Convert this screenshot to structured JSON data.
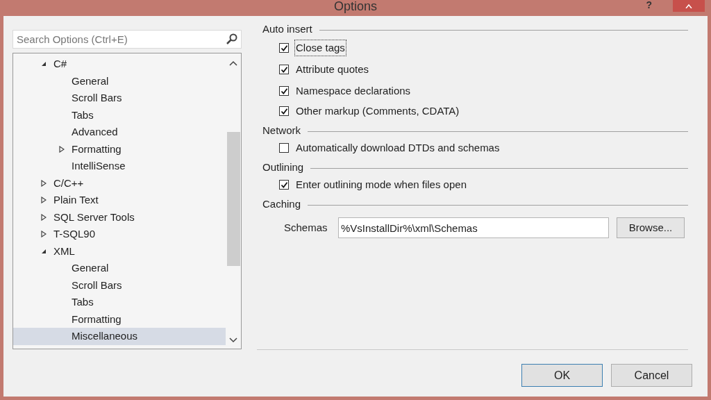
{
  "window": {
    "title": "Options",
    "help": "?"
  },
  "search": {
    "placeholder": "Search Options (Ctrl+E)"
  },
  "tree": [
    {
      "label": "C#",
      "kind": "folder",
      "expanded": true,
      "selected": false,
      "children": [
        {
          "label": "General",
          "kind": "page",
          "selected": false
        },
        {
          "label": "Scroll Bars",
          "kind": "page",
          "selected": false
        },
        {
          "label": "Tabs",
          "kind": "page",
          "selected": false
        },
        {
          "label": "Advanced",
          "kind": "page",
          "selected": false
        },
        {
          "label": "Formatting",
          "kind": "folder",
          "expanded": false,
          "selected": false
        },
        {
          "label": "IntelliSense",
          "kind": "page",
          "selected": false
        }
      ]
    },
    {
      "label": "C/C++",
      "kind": "folder",
      "expanded": false,
      "selected": false
    },
    {
      "label": "Plain Text",
      "kind": "folder",
      "expanded": false,
      "selected": false
    },
    {
      "label": "SQL Server Tools",
      "kind": "folder",
      "expanded": false,
      "selected": false
    },
    {
      "label": "T-SQL90",
      "kind": "folder",
      "expanded": false,
      "selected": false
    },
    {
      "label": "XML",
      "kind": "folder",
      "expanded": true,
      "selected": false,
      "children": [
        {
          "label": "General",
          "kind": "page",
          "selected": false
        },
        {
          "label": "Scroll Bars",
          "kind": "page",
          "selected": false
        },
        {
          "label": "Tabs",
          "kind": "page",
          "selected": false
        },
        {
          "label": "Formatting",
          "kind": "page",
          "selected": false
        },
        {
          "label": "Miscellaneous",
          "kind": "page",
          "selected": true
        }
      ]
    }
  ],
  "groups": [
    {
      "title": "Auto insert",
      "options": [
        {
          "label": "Close tags",
          "checked": true,
          "focused": true
        },
        {
          "label": "Attribute quotes",
          "checked": true,
          "focused": false
        },
        {
          "label": "Namespace declarations",
          "checked": true,
          "focused": false
        },
        {
          "label": "Other markup (Comments, CDATA)",
          "checked": true,
          "focused": false
        }
      ]
    },
    {
      "title": "Network",
      "options": [
        {
          "label": "Automatically download DTDs and schemas",
          "checked": false,
          "focused": false
        }
      ]
    },
    {
      "title": "Outlining",
      "options": [
        {
          "label": "Enter outlining mode when files open",
          "checked": true,
          "focused": false
        }
      ]
    },
    {
      "title": "Caching",
      "field": {
        "label": "Schemas",
        "value": "%VsInstallDir%\\xml\\Schemas",
        "button": "Browse..."
      }
    }
  ],
  "buttons": [
    "OK",
    "Cancel"
  ]
}
